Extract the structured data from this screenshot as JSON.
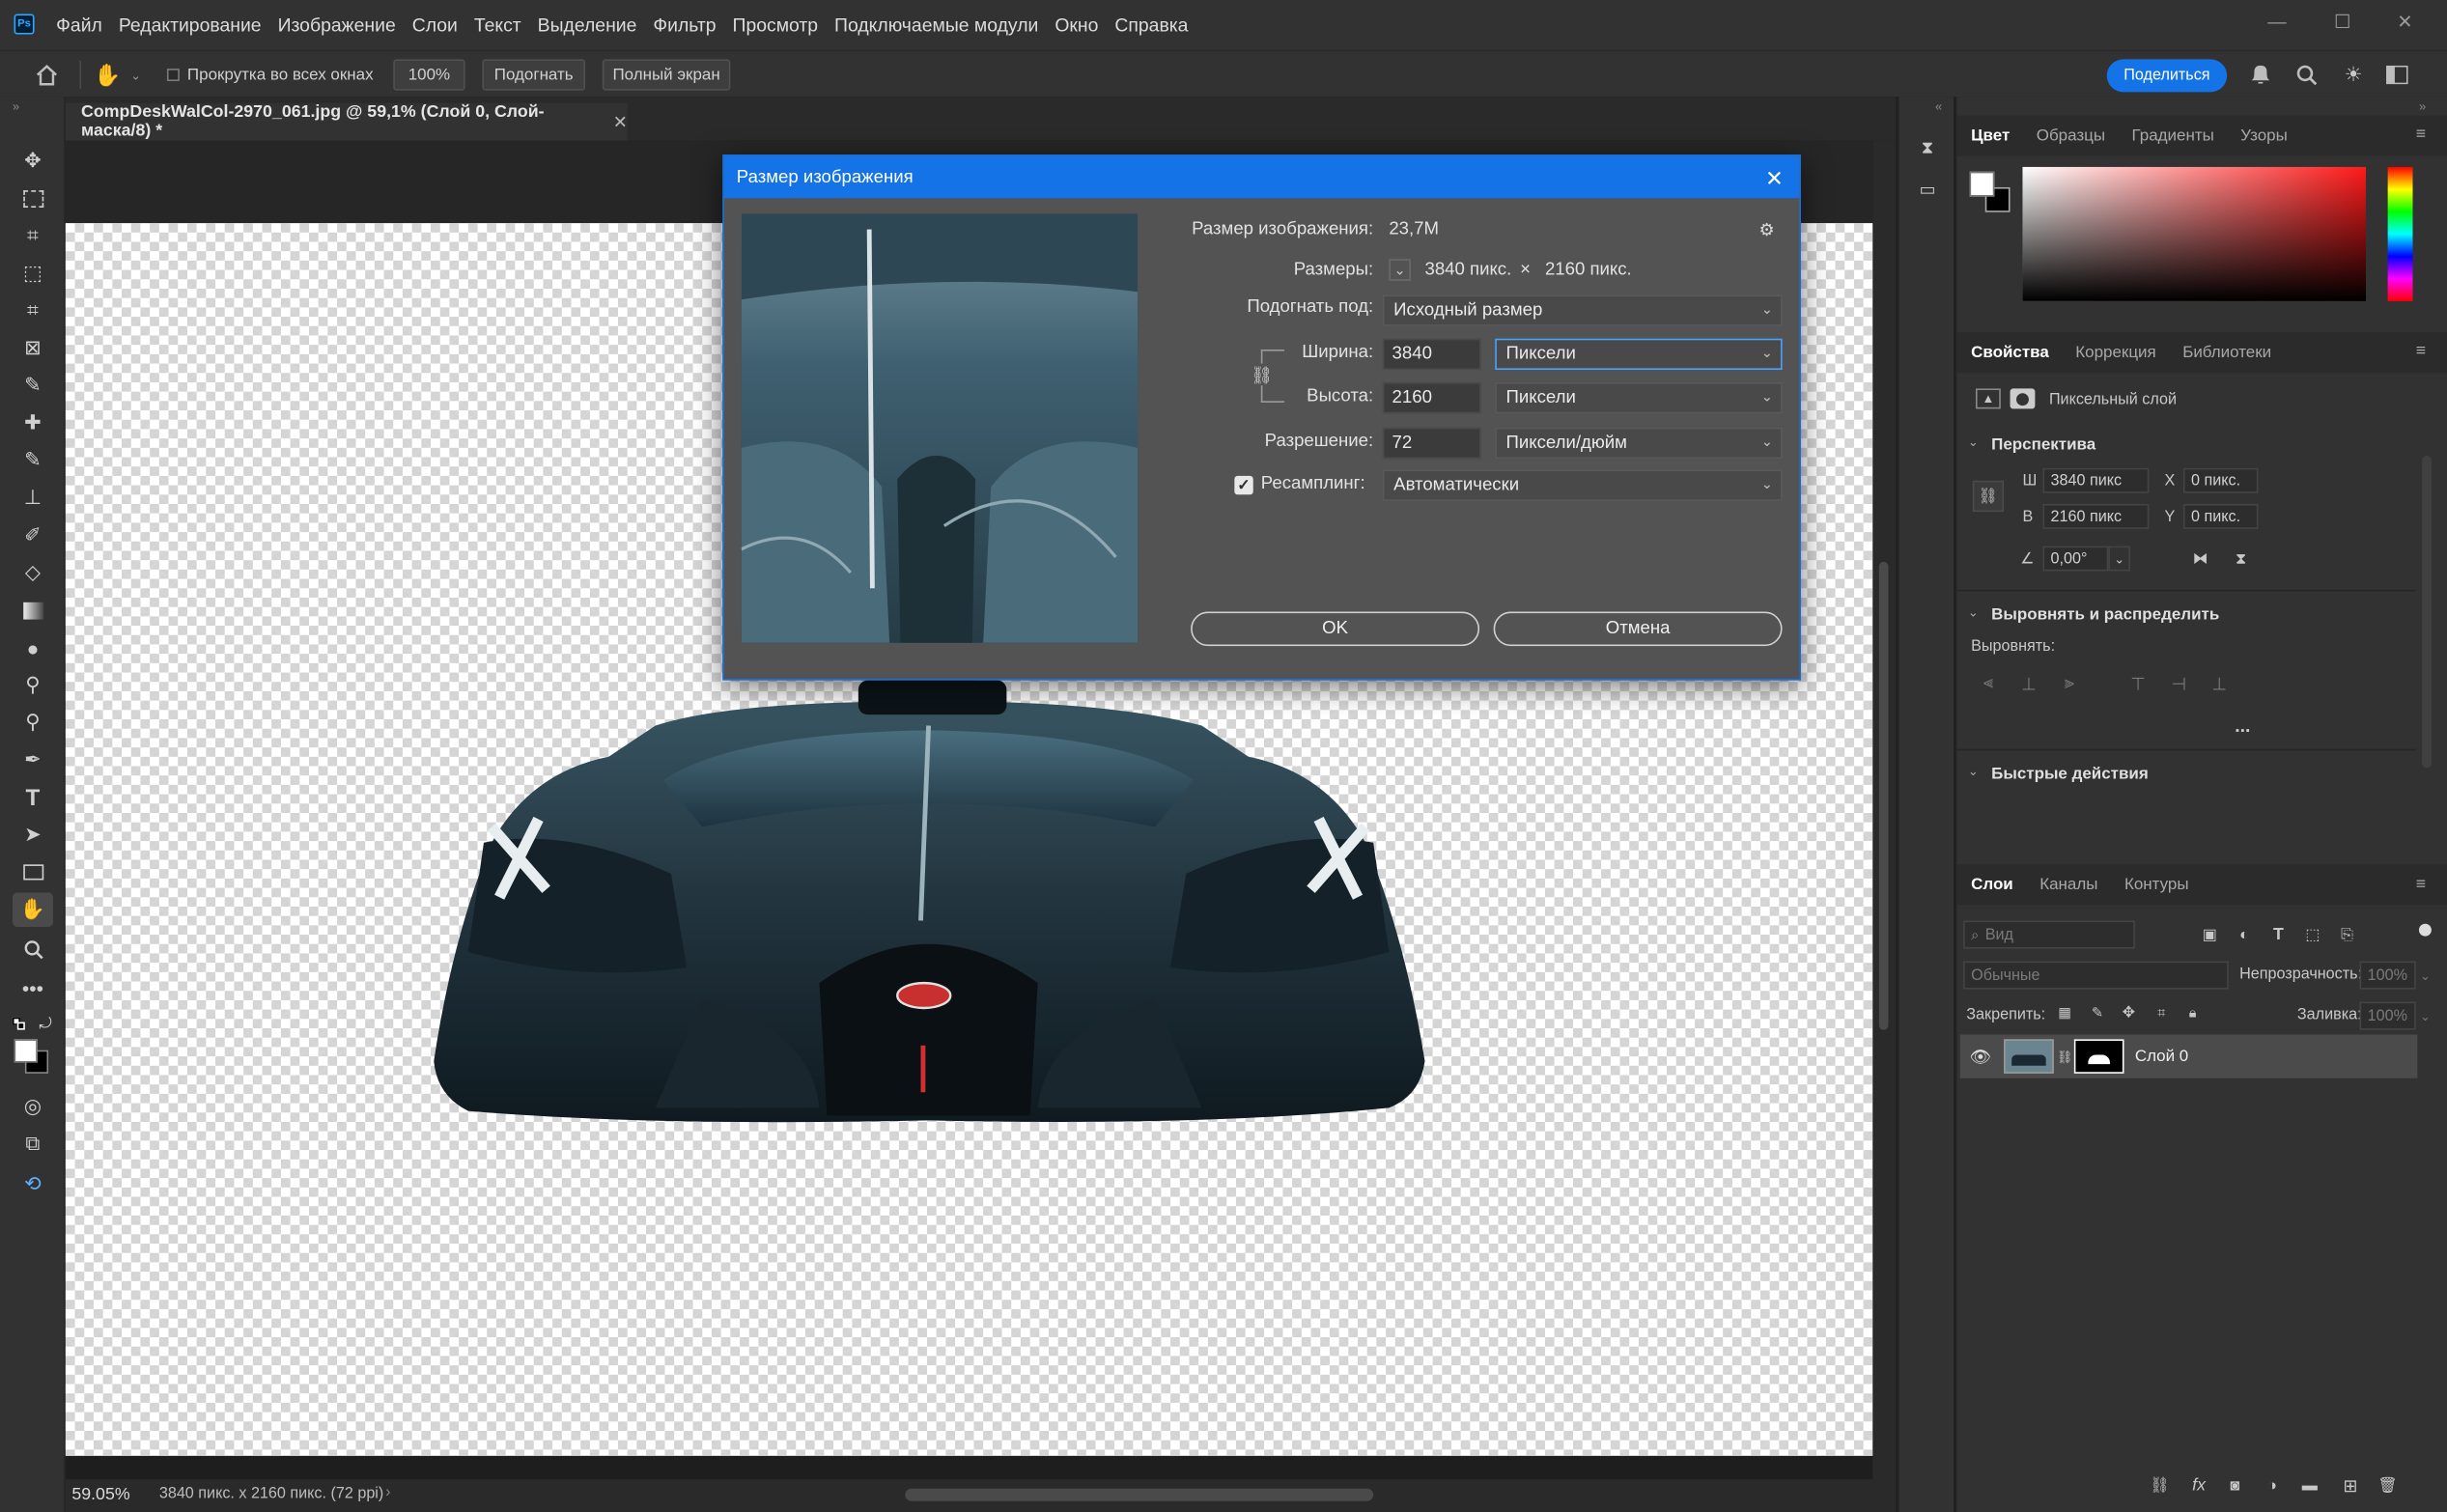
{
  "app": {
    "logo": "Ps"
  },
  "menu": [
    "Файл",
    "Редактирование",
    "Изображение",
    "Слои",
    "Текст",
    "Выделение",
    "Фильтр",
    "Просмотр",
    "Подключаемые модули",
    "Окно",
    "Справка"
  ],
  "options": {
    "scroll_all": "Прокрутка во всех окнах",
    "zoom": "100%",
    "fit": "Подогнать",
    "fullscreen": "Полный экран",
    "share": "Поделиться"
  },
  "document": {
    "tab_title": "CompDeskWalCol-2970_061.jpg @ 59,1% (Слой 0, Слой-маска/8) *",
    "status_zoom": "59.05%",
    "status_info": "3840 пикс. x 2160 пикс. (72 ppi)"
  },
  "dialog": {
    "title": "Размер изображения",
    "size_label": "Размер изображения:",
    "size_value": "23,7M",
    "dims_label": "Размеры:",
    "dims_w": "3840 пикс.",
    "dims_x": "×",
    "dims_h": "2160 пикс.",
    "fit_label": "Подогнать под:",
    "fit_value": "Исходный размер",
    "width_label": "Ширина:",
    "width_value": "3840",
    "width_unit": "Пиксели",
    "height_label": "Высота:",
    "height_value": "2160",
    "height_unit": "Пиксели",
    "res_label": "Разрешение:",
    "res_value": "72",
    "res_unit": "Пиксели/дюйм",
    "resample_label": "Ресамплинг:",
    "resample_value": "Автоматически",
    "ok": "OK",
    "cancel": "Отмена"
  },
  "color_panel": {
    "tabs": [
      "Цвет",
      "Образцы",
      "Градиенты",
      "Узоры"
    ]
  },
  "properties": {
    "tabs": [
      "Свойства",
      "Коррекция",
      "Библиотеки"
    ],
    "layer_type": "Пиксельный слой",
    "perspective": "Перспектива",
    "w_label": "Ш",
    "w_value": "3840 пикс",
    "h_label": "В",
    "h_value": "2160 пикс",
    "x_label": "X",
    "x_value": "0 пикс.",
    "y_label": "Y",
    "y_value": "0 пикс.",
    "angle_value": "0,00°",
    "align_header": "Выровнять и распределить",
    "align_label": "Выровнять:",
    "more": "...",
    "quick_actions": "Быстрые действия"
  },
  "layers": {
    "tabs": [
      "Слои",
      "Каналы",
      "Контуры"
    ],
    "search_placeholder": "Вид",
    "blend_mode": "Обычные",
    "opacity_label": "Непрозрачность:",
    "opacity_value": "100%",
    "lock_label": "Закрепить:",
    "fill_label": "Заливка:",
    "fill_value": "100%",
    "layer_name": "Слой 0",
    "fx": "fx"
  }
}
